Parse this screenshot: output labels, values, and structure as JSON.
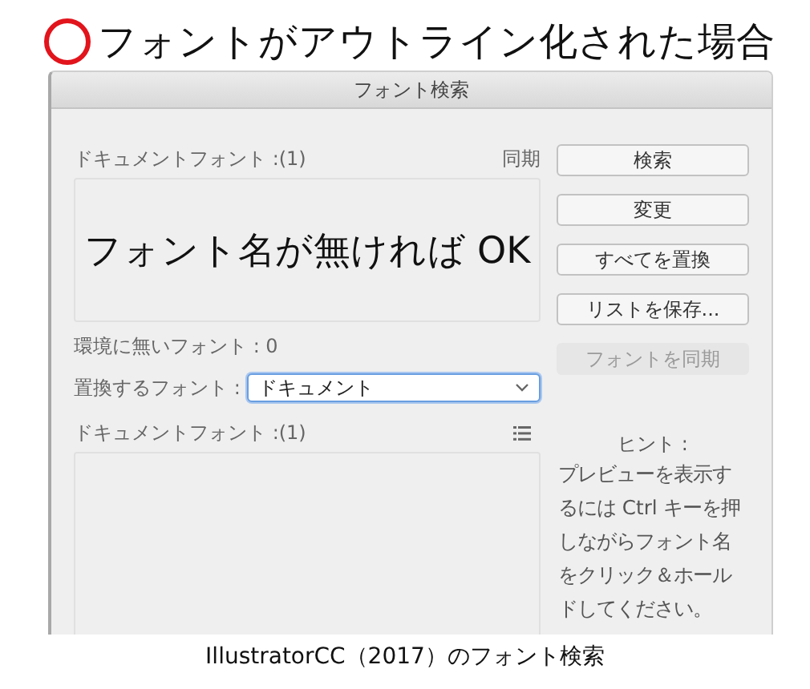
{
  "heading": {
    "text": "フォントがアウトライン化された場合"
  },
  "dialog": {
    "title": "フォント検索",
    "document_fonts": {
      "label": "ドキュメントフォント :(1)",
      "sync_label": "同期",
      "list_note": "フォント名が無ければ OK"
    },
    "missing_fonts": "環境に無いフォント : 0",
    "replace": {
      "label": "置換するフォント :",
      "value": "ドキュメント",
      "focused": true
    },
    "replacement_fonts": {
      "label": "ドキュメントフォント :(1)"
    },
    "buttons": [
      {
        "label": "検索",
        "disabled": false
      },
      {
        "label": "変更",
        "disabled": false
      },
      {
        "label": "すべてを置換",
        "disabled": false
      },
      {
        "label": "リストを保存...",
        "disabled": false
      },
      {
        "label": "フォントを同期",
        "disabled": true
      }
    ],
    "hint": {
      "title": "ヒント :",
      "text": "プレビューを表示するには Ctrl キーを押しながらフォント名をクリック＆ホールドしてください。"
    }
  },
  "caption": "IllustratorCC（2017）のフォント検索"
}
